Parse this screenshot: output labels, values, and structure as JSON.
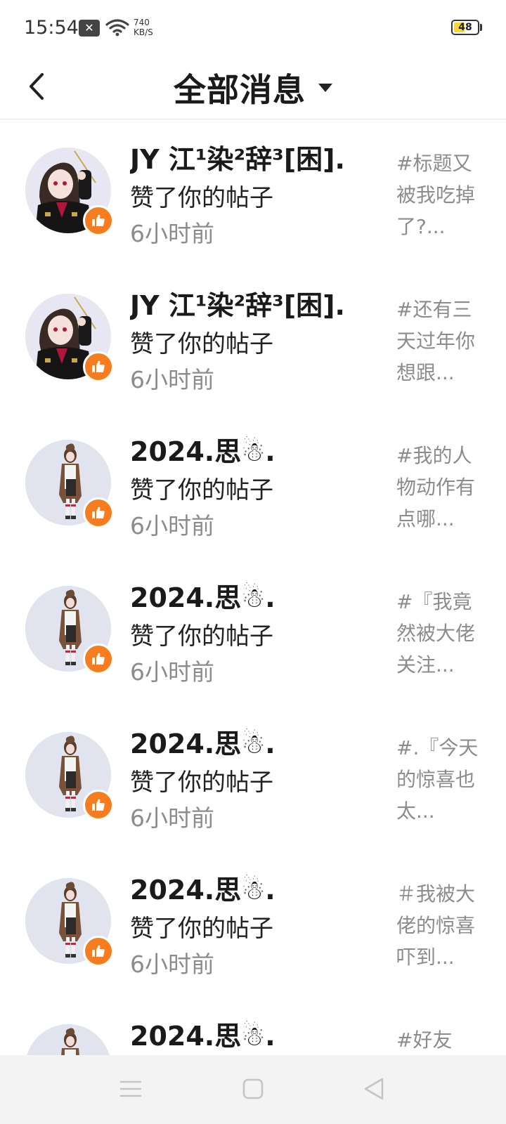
{
  "status_bar": {
    "time": "15:54",
    "notification_icon": "x-box-icon",
    "wifi_icon": "wifi-icon",
    "net_speed_value": "740",
    "net_speed_unit": "KB/S",
    "battery_level": "48",
    "battery_fill_percent": 48
  },
  "header": {
    "back_icon": "chevron-left-icon",
    "title": "全部消息",
    "dropdown_icon": "caret-down-icon"
  },
  "colors": {
    "accent_orange": "#f57c1f",
    "text_primary": "#1a1a1a",
    "text_secondary": "#8c8c8c",
    "avatar_bg": "#e1e4ef",
    "battery_yellow": "#f5d63d"
  },
  "messages": [
    {
      "name": "JY 江¹染²辞³[困].",
      "action": "赞了你的帖子",
      "time": "6小时前",
      "preview": "#标题又被我吃掉了?...",
      "avatar": "dark-costume-girl",
      "badge_icon": "thumbs-up-icon"
    },
    {
      "name": "JY 江¹染²辞³[困].",
      "action": "赞了你的帖子",
      "time": "6小时前",
      "preview": "#还有三天过年你想跟...",
      "avatar": "dark-costume-girl",
      "badge_icon": "thumbs-up-icon"
    },
    {
      "name": "2024.思☃.",
      "action": "赞了你的帖子",
      "time": "6小时前",
      "preview": "#我的人物动作有点哪...",
      "avatar": "brown-coat-girl",
      "badge_icon": "thumbs-up-icon"
    },
    {
      "name": "2024.思☃.",
      "action": "赞了你的帖子",
      "time": "6小时前",
      "preview": "#『我竟然被大佬关注...",
      "avatar": "brown-coat-girl",
      "badge_icon": "thumbs-up-icon"
    },
    {
      "name": "2024.思☃.",
      "action": "赞了你的帖子",
      "time": "6小时前",
      "preview": "#.『今天的惊喜也太...",
      "avatar": "brown-coat-girl",
      "badge_icon": "thumbs-up-icon"
    },
    {
      "name": "2024.思☃.",
      "action": "赞了你的帖子",
      "time": "6小时前",
      "preview": "＃我被大佬的惊喜吓到...",
      "avatar": "brown-coat-girl",
      "badge_icon": "thumbs-up-icon"
    },
    {
      "name": "2024.思☃.",
      "action": "",
      "time": "",
      "preview": "#好友",
      "avatar": "brown-coat-girl",
      "badge_icon": "thumbs-up-icon"
    }
  ],
  "nav_bar": {
    "menu_icon": "menu-lines-icon",
    "home_icon": "square-home-icon",
    "back_icon": "triangle-back-icon"
  }
}
